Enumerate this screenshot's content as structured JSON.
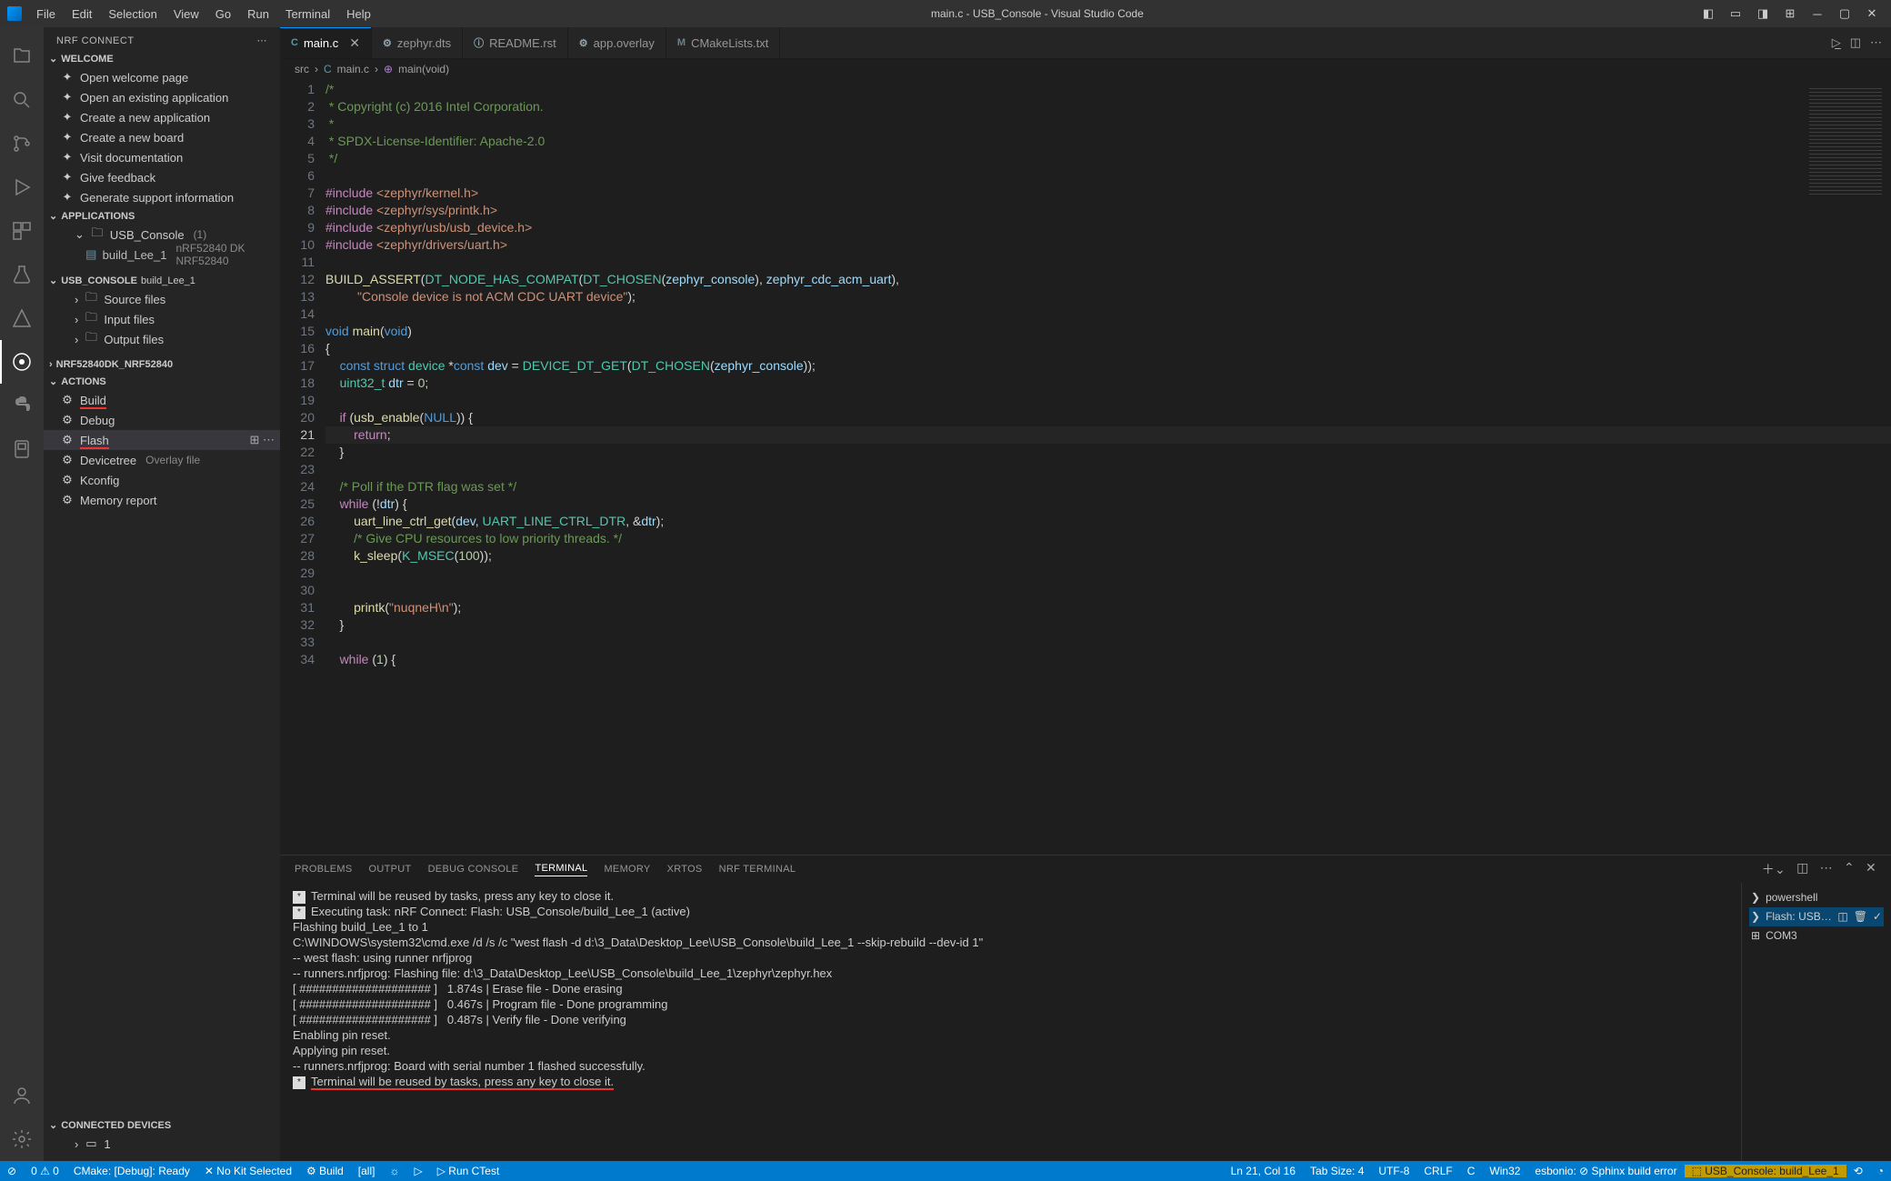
{
  "title": "main.c - USB_Console - Visual Studio Code",
  "menu": [
    "File",
    "Edit",
    "Selection",
    "View",
    "Go",
    "Run",
    "Terminal",
    "Help"
  ],
  "side": {
    "header": "NRF CONNECT",
    "welcome": "WELCOME",
    "welcome_items": [
      {
        "label": "Open welcome page",
        "icon": "home-icon"
      },
      {
        "label": "Open an existing application",
        "icon": "add-icon"
      },
      {
        "label": "Create a new application",
        "icon": "new-icon"
      },
      {
        "label": "Create a new board",
        "icon": "board-icon"
      },
      {
        "label": "Visit documentation",
        "icon": "book-icon"
      },
      {
        "label": "Give feedback",
        "icon": "feedback-icon"
      },
      {
        "label": "Generate support information",
        "icon": "support-icon"
      }
    ],
    "applications": "APPLICATIONS",
    "app_name": "USB_Console",
    "app_count": "(1)",
    "build_name": "build_Lee_1",
    "build_board": "nRF52840 DK NRF52840",
    "usb_console": "USB_CONSOLE",
    "usb_console_sub": "build_Lee_1",
    "folders": [
      "Source files",
      "Input files",
      "Output files"
    ],
    "nrf_section": "NRF52840DK_NRF52840",
    "actions": "ACTIONS",
    "action_items": [
      {
        "label": "Build",
        "icon": "build-icon",
        "ul": true
      },
      {
        "label": "Debug",
        "icon": "debug-icon"
      },
      {
        "label": "Flash",
        "icon": "flash-icon",
        "ul": true,
        "hover": true
      },
      {
        "label": "Devicetree",
        "icon": "tree-icon",
        "secondary": "Overlay file"
      },
      {
        "label": "Kconfig",
        "icon": "gear-icon"
      },
      {
        "label": "Memory report",
        "icon": "memory-icon"
      }
    ],
    "connected": "CONNECTED DEVICES",
    "connected_count": "1"
  },
  "tabs": [
    {
      "icon": "C",
      "label": "main.c",
      "active": true,
      "close": true,
      "color": "#519aba"
    },
    {
      "icon": "⚙",
      "label": "zephyr.dts",
      "color": "#90a4ae"
    },
    {
      "icon": "ⓘ",
      "label": "README.rst",
      "color": "#90a4ae"
    },
    {
      "icon": "⚙",
      "label": "app.overlay",
      "color": "#90a4ae"
    },
    {
      "icon": "M",
      "label": "CMakeLists.txt",
      "color": "#6d8086"
    }
  ],
  "breadcrumb": {
    "p1": "src",
    "p2": "main.c",
    "p3": "main(void)"
  },
  "code_lines": [
    {
      "n": 1,
      "html": "<span class='tok-com'>/*</span>"
    },
    {
      "n": 2,
      "html": "<span class='tok-com'> * Copyright (c) 2016 Intel Corporation.</span>"
    },
    {
      "n": 3,
      "html": "<span class='tok-com'> *</span>"
    },
    {
      "n": 4,
      "html": "<span class='tok-com'> * SPDX-License-Identifier: Apache-2.0</span>"
    },
    {
      "n": 5,
      "html": "<span class='tok-com'> */</span>"
    },
    {
      "n": 6,
      "html": ""
    },
    {
      "n": 7,
      "html": "<span class='tok-pre'>#include</span> <span class='tok-str'>&lt;zephyr/kernel.h&gt;</span>"
    },
    {
      "n": 8,
      "html": "<span class='tok-pre'>#include</span> <span class='tok-str'>&lt;zephyr/sys/printk.h&gt;</span>"
    },
    {
      "n": 9,
      "html": "<span class='tok-pre'>#include</span> <span class='tok-str'>&lt;zephyr/usb/usb_device.h&gt;</span>"
    },
    {
      "n": 10,
      "html": "<span class='tok-pre'>#include</span> <span class='tok-str'>&lt;zephyr/drivers/uart.h&gt;</span>"
    },
    {
      "n": 11,
      "html": ""
    },
    {
      "n": 12,
      "html": "<span class='tok-fn'>BUILD_ASSERT</span>(<span class='tok-macro'>DT_NODE_HAS_COMPAT</span>(<span class='tok-macro'>DT_CHOSEN</span>(<span class='tok-var'>zephyr_console</span>), <span class='tok-var'>zephyr_cdc_acm_uart</span>),"
    },
    {
      "n": 13,
      "html": "         <span class='tok-str'>\"Console device is not ACM CDC UART device\"</span>);"
    },
    {
      "n": 14,
      "html": ""
    },
    {
      "n": 15,
      "html": "<span class='tok-kw'>void</span> <span class='tok-fn'>main</span>(<span class='tok-kw'>void</span>)"
    },
    {
      "n": 16,
      "html": "{"
    },
    {
      "n": 17,
      "html": "    <span class='tok-kw'>const</span> <span class='tok-kw'>struct</span> <span class='tok-macro'>device</span> *<span class='tok-kw'>const</span> <span class='tok-var'>dev</span> = <span class='tok-macro'>DEVICE_DT_GET</span>(<span class='tok-macro'>DT_CHOSEN</span>(<span class='tok-var'>zephyr_console</span>));"
    },
    {
      "n": 18,
      "html": "    <span class='tok-macro'>uint32_t</span> <span class='tok-var'>dtr</span> = <span class='tok-num'>0</span>;"
    },
    {
      "n": 19,
      "html": ""
    },
    {
      "n": 20,
      "html": "    <span class='tok-pre'>if</span> (<span class='tok-fn'>usb_enable</span>(<span class='tok-kw'>NULL</span>)) {"
    },
    {
      "n": 21,
      "html": "        <span class='tok-pre'>return</span>;",
      "cur": true
    },
    {
      "n": 22,
      "html": "    }"
    },
    {
      "n": 23,
      "html": ""
    },
    {
      "n": 24,
      "html": "    <span class='tok-com'>/* Poll if the DTR flag was set */</span>"
    },
    {
      "n": 25,
      "html": "    <span class='tok-pre'>while</span> (!<span class='tok-var'>dtr</span>) {"
    },
    {
      "n": 26,
      "html": "        <span class='tok-fn'>uart_line_ctrl_get</span>(<span class='tok-var'>dev</span>, <span class='tok-macro'>UART_LINE_CTRL_DTR</span>, &amp;<span class='tok-var'>dtr</span>);"
    },
    {
      "n": 27,
      "html": "        <span class='tok-com'>/* Give CPU resources to low priority threads. */</span>"
    },
    {
      "n": 28,
      "html": "        <span class='tok-fn'>k_sleep</span>(<span class='tok-macro'>K_MSEC</span>(<span class='tok-num'>100</span>));"
    },
    {
      "n": 29,
      "html": ""
    },
    {
      "n": 30,
      "html": ""
    },
    {
      "n": 31,
      "html": "        <span class='tok-fn'>printk</span>(<span class='tok-str'>\"nuqneH\\n\"</span>);"
    },
    {
      "n": 32,
      "html": "    }"
    },
    {
      "n": 33,
      "html": ""
    },
    {
      "n": 34,
      "html": "    <span class='tok-pre'>while</span> (<span class='tok-num'>1</span>) {"
    }
  ],
  "panel": {
    "tabs": [
      "PROBLEMS",
      "OUTPUT",
      "DEBUG CONSOLE",
      "TERMINAL",
      "MEMORY",
      "XRTOS",
      "NRF TERMINAL"
    ],
    "active": "TERMINAL",
    "terminal_lines": [
      {
        "star": true,
        "t": "Terminal will be reused by tasks, press any key to close it."
      },
      {
        "t": ""
      },
      {
        "star": true,
        "t": "Executing task: nRF Connect: Flash: USB_Console/build_Lee_1 (active)"
      },
      {
        "t": ""
      },
      {
        "t": "Flashing build_Lee_1 to 1"
      },
      {
        "t": "C:\\WINDOWS\\system32\\cmd.exe /d /s /c \"west flash -d d:\\3_Data\\Desktop_Lee\\USB_Console\\build_Lee_1 --skip-rebuild --dev-id 1\""
      },
      {
        "t": ""
      },
      {
        "t": "-- west flash: using runner nrfjprog"
      },
      {
        "t": "-- runners.nrfjprog: Flashing file: d:\\3_Data\\Desktop_Lee\\USB_Console\\build_Lee_1\\zephyr\\zephyr.hex"
      },
      {
        "t": "[ #################### ]   1.874s | Erase file - Done erasing"
      },
      {
        "t": "[ #################### ]   0.467s | Program file - Done programming"
      },
      {
        "t": "[ #################### ]   0.487s | Verify file - Done verifying"
      },
      {
        "t": "Enabling pin reset."
      },
      {
        "t": "Applying pin reset."
      },
      {
        "t": "-- runners.nrfjprog: Board with serial number 1 flashed successfully."
      },
      {
        "star": true,
        "t": "Terminal will be reused by tasks, press any key to close it.",
        "ul": true
      }
    ],
    "sessions": [
      {
        "icon": "❯",
        "label": "powershell"
      },
      {
        "icon": "❯",
        "label": "Flash: USB_Conso...",
        "active": true,
        "extras": true
      },
      {
        "icon": "⊞",
        "label": "COM3"
      }
    ]
  },
  "status": {
    "left": [
      {
        "icon": "⊘",
        "text": ""
      },
      {
        "text": "0 ⚠ 0"
      },
      {
        "text": "CMake: [Debug]: Ready"
      },
      {
        "text": "✕ No Kit Selected"
      },
      {
        "text": "⚙ Build"
      },
      {
        "text": "[all]"
      },
      {
        "text": "☼"
      },
      {
        "text": "▷"
      },
      {
        "text": "▷ Run CTest"
      }
    ],
    "right": [
      {
        "text": "Ln 21, Col 16"
      },
      {
        "text": "Tab Size: 4"
      },
      {
        "text": "UTF-8"
      },
      {
        "text": "CRLF"
      },
      {
        "text": "C"
      },
      {
        "text": "Win32"
      },
      {
        "text": "esbonio: ⊘ Sphinx build error"
      },
      {
        "text": "⬚ USB_Console: build_Lee_1",
        "warn": true
      },
      {
        "text": "⟲"
      },
      {
        "text": "◔"
      }
    ]
  }
}
